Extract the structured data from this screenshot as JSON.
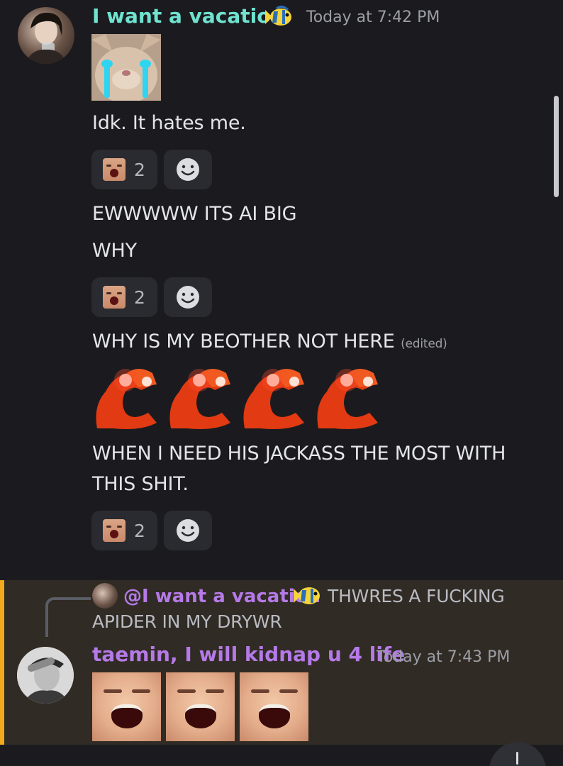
{
  "message_group_1": {
    "username": "I want a vacation",
    "username_color": "#6fe3d0",
    "timestamp": "Today at 7:42 PM",
    "messages": [
      {
        "text": "Idk. It hates me."
      },
      {
        "text": "EWWWWW ITS AI BIG"
      },
      {
        "text": "WHY"
      },
      {
        "text": "WHY IS MY BEOTHER NOT HERE",
        "edited": "(edited)"
      },
      {
        "text_line1": "WHEN I NEED HIS JACKASS THE MOST WITH",
        "text_line2": "THIS SHIT."
      }
    ],
    "reactions": [
      {
        "count": "2"
      },
      {
        "count": "2"
      },
      {
        "count": "2"
      }
    ]
  },
  "reply": {
    "mention": "@I want a vacation",
    "quoted_line1": "THWRES A FUCKING",
    "quoted_line2": "APIDER IN MY DRYWR"
  },
  "message_group_2": {
    "username": "taemin, I will kidnap u 4 life",
    "username_color": "#b57ae8",
    "timestamp": "Today at 7:43 PM"
  },
  "colors": {
    "background": "#1b1b1f",
    "reply_highlight": "#302b24",
    "reply_border": "#f2a91e"
  },
  "icons": [
    "fish-emoji-icon",
    "crying-cat-sticker",
    "crying-face-reaction-icon",
    "add-reaction-smiley-icon",
    "nazare-meme-emoji",
    "laughing-face-emoji",
    "scroll-down-button"
  ]
}
